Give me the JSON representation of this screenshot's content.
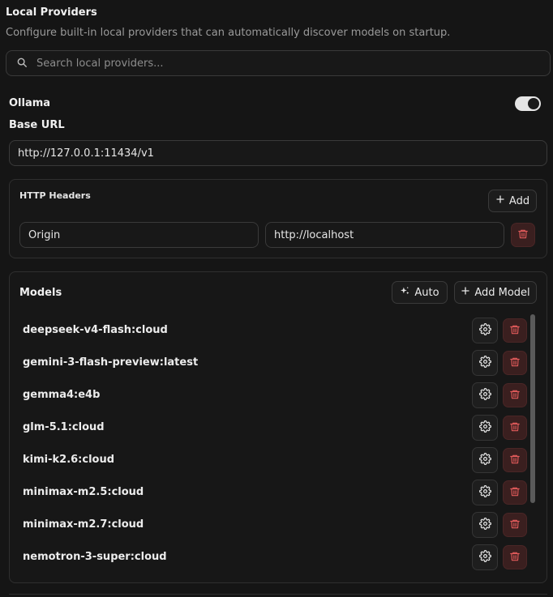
{
  "section": {
    "title": "Local Providers",
    "description": "Configure built-in local providers that can automatically discover models on startup."
  },
  "search": {
    "placeholder": "Search local providers...",
    "icon": "search-icon"
  },
  "provider": {
    "name": "Ollama",
    "enabled": true,
    "base_url_label": "Base URL",
    "base_url_value": "http://127.0.0.1:11434/v1"
  },
  "http_headers": {
    "title": "HTTP Headers",
    "add_label": "Add",
    "rows": [
      {
        "key": "Origin",
        "value": "http://localhost"
      }
    ]
  },
  "models": {
    "title": "Models",
    "auto_label": "Auto",
    "add_label": "Add Model",
    "items": [
      "deepseek-v4-flash:cloud",
      "gemini-3-flash-preview:latest",
      "gemma4:e4b",
      "glm-5.1:cloud",
      "kimi-k2.6:cloud",
      "minimax-m2.5:cloud",
      "minimax-m2.7:cloud",
      "nemotron-3-super:cloud"
    ]
  },
  "colors": {
    "background": "#151515",
    "danger": "#e05a5a",
    "danger_bg": "#3a1f1f",
    "toggle_on": "#e4e4e4"
  }
}
